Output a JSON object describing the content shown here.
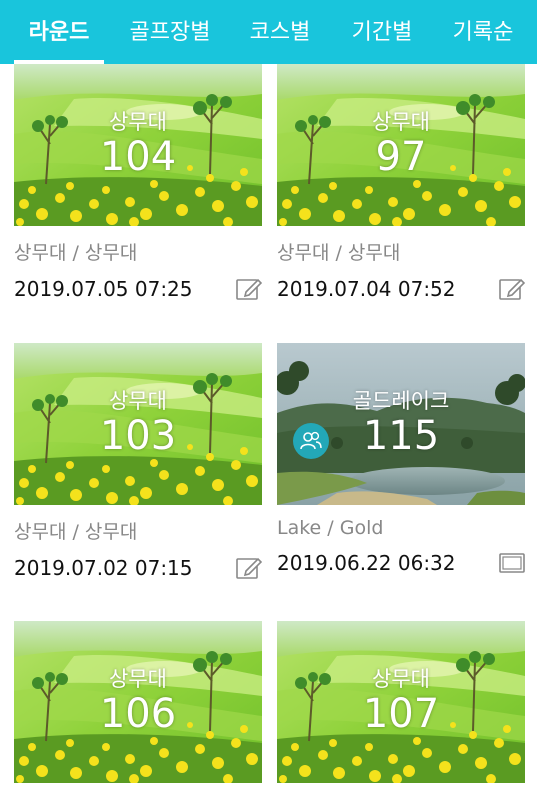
{
  "tabs": [
    {
      "label": "라운드",
      "active": true
    },
    {
      "label": "골프장별",
      "active": false
    },
    {
      "label": "코스별",
      "active": false
    },
    {
      "label": "기간별",
      "active": false
    },
    {
      "label": "기록순",
      "active": false
    }
  ],
  "rounds": [
    {
      "course": "상무대",
      "score": "104",
      "sub": "상무대 / 상무대",
      "datetime": "2019.07.05 07:25",
      "image": "golf-course-flowers",
      "action_icon": "edit-icon"
    },
    {
      "course": "상무대",
      "score": "97",
      "sub": "상무대 / 상무대",
      "datetime": "2019.07.04 07:52",
      "image": "golf-course-flowers",
      "action_icon": "edit-icon"
    },
    {
      "course": "상무대",
      "score": "103",
      "sub": "상무대 / 상무대",
      "datetime": "2019.07.02 07:15",
      "image": "golf-course-flowers",
      "action_icon": "edit-icon"
    },
    {
      "course": "골드레이크",
      "score": "115",
      "sub": "Lake / Gold",
      "datetime": "2019.06.22 06:32",
      "image": "golf-course-lake",
      "action_icon": "scorecard-icon",
      "badge_icon": "group-icon"
    },
    {
      "course": "상무대",
      "score": "106",
      "sub": "",
      "datetime": "",
      "image": "golf-course-flowers",
      "action_icon": ""
    },
    {
      "course": "상무대",
      "score": "107",
      "sub": "",
      "datetime": "",
      "image": "golf-course-flowers",
      "action_icon": ""
    }
  ],
  "colors": {
    "tabbar": "#19c5dc",
    "badge": "#23a8b8"
  }
}
